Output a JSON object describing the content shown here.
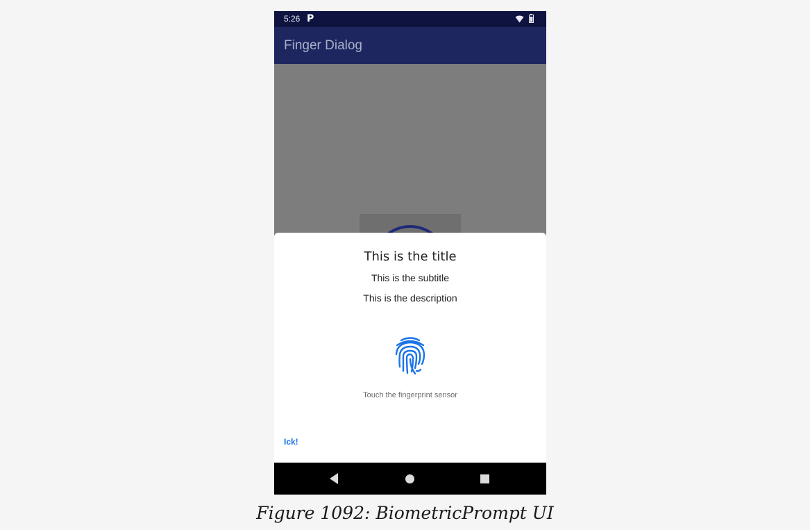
{
  "status_bar": {
    "time": "5:26",
    "notification_icon": "pandora-p-icon",
    "wifi_icon": "wifi-icon",
    "battery_icon": "battery-icon"
  },
  "app_bar": {
    "title": "Finger Dialog"
  },
  "biometric_prompt": {
    "title": "This is the title",
    "subtitle": "This is the subtitle",
    "description": "This is the description",
    "icon": "fingerprint-icon",
    "hint": "Touch the fingerprint sensor",
    "negative_button": "Ick!"
  },
  "nav_bar": {
    "back_icon": "back-triangle-icon",
    "home_icon": "home-circle-icon",
    "recents_icon": "recents-square-icon"
  },
  "colors": {
    "status_bar": "#0e1340",
    "app_bar": "#1e2660",
    "scrim": "#7d7d7d",
    "accent": "#1a73e8"
  },
  "caption": "Figure 1092: BiometricPrompt UI"
}
